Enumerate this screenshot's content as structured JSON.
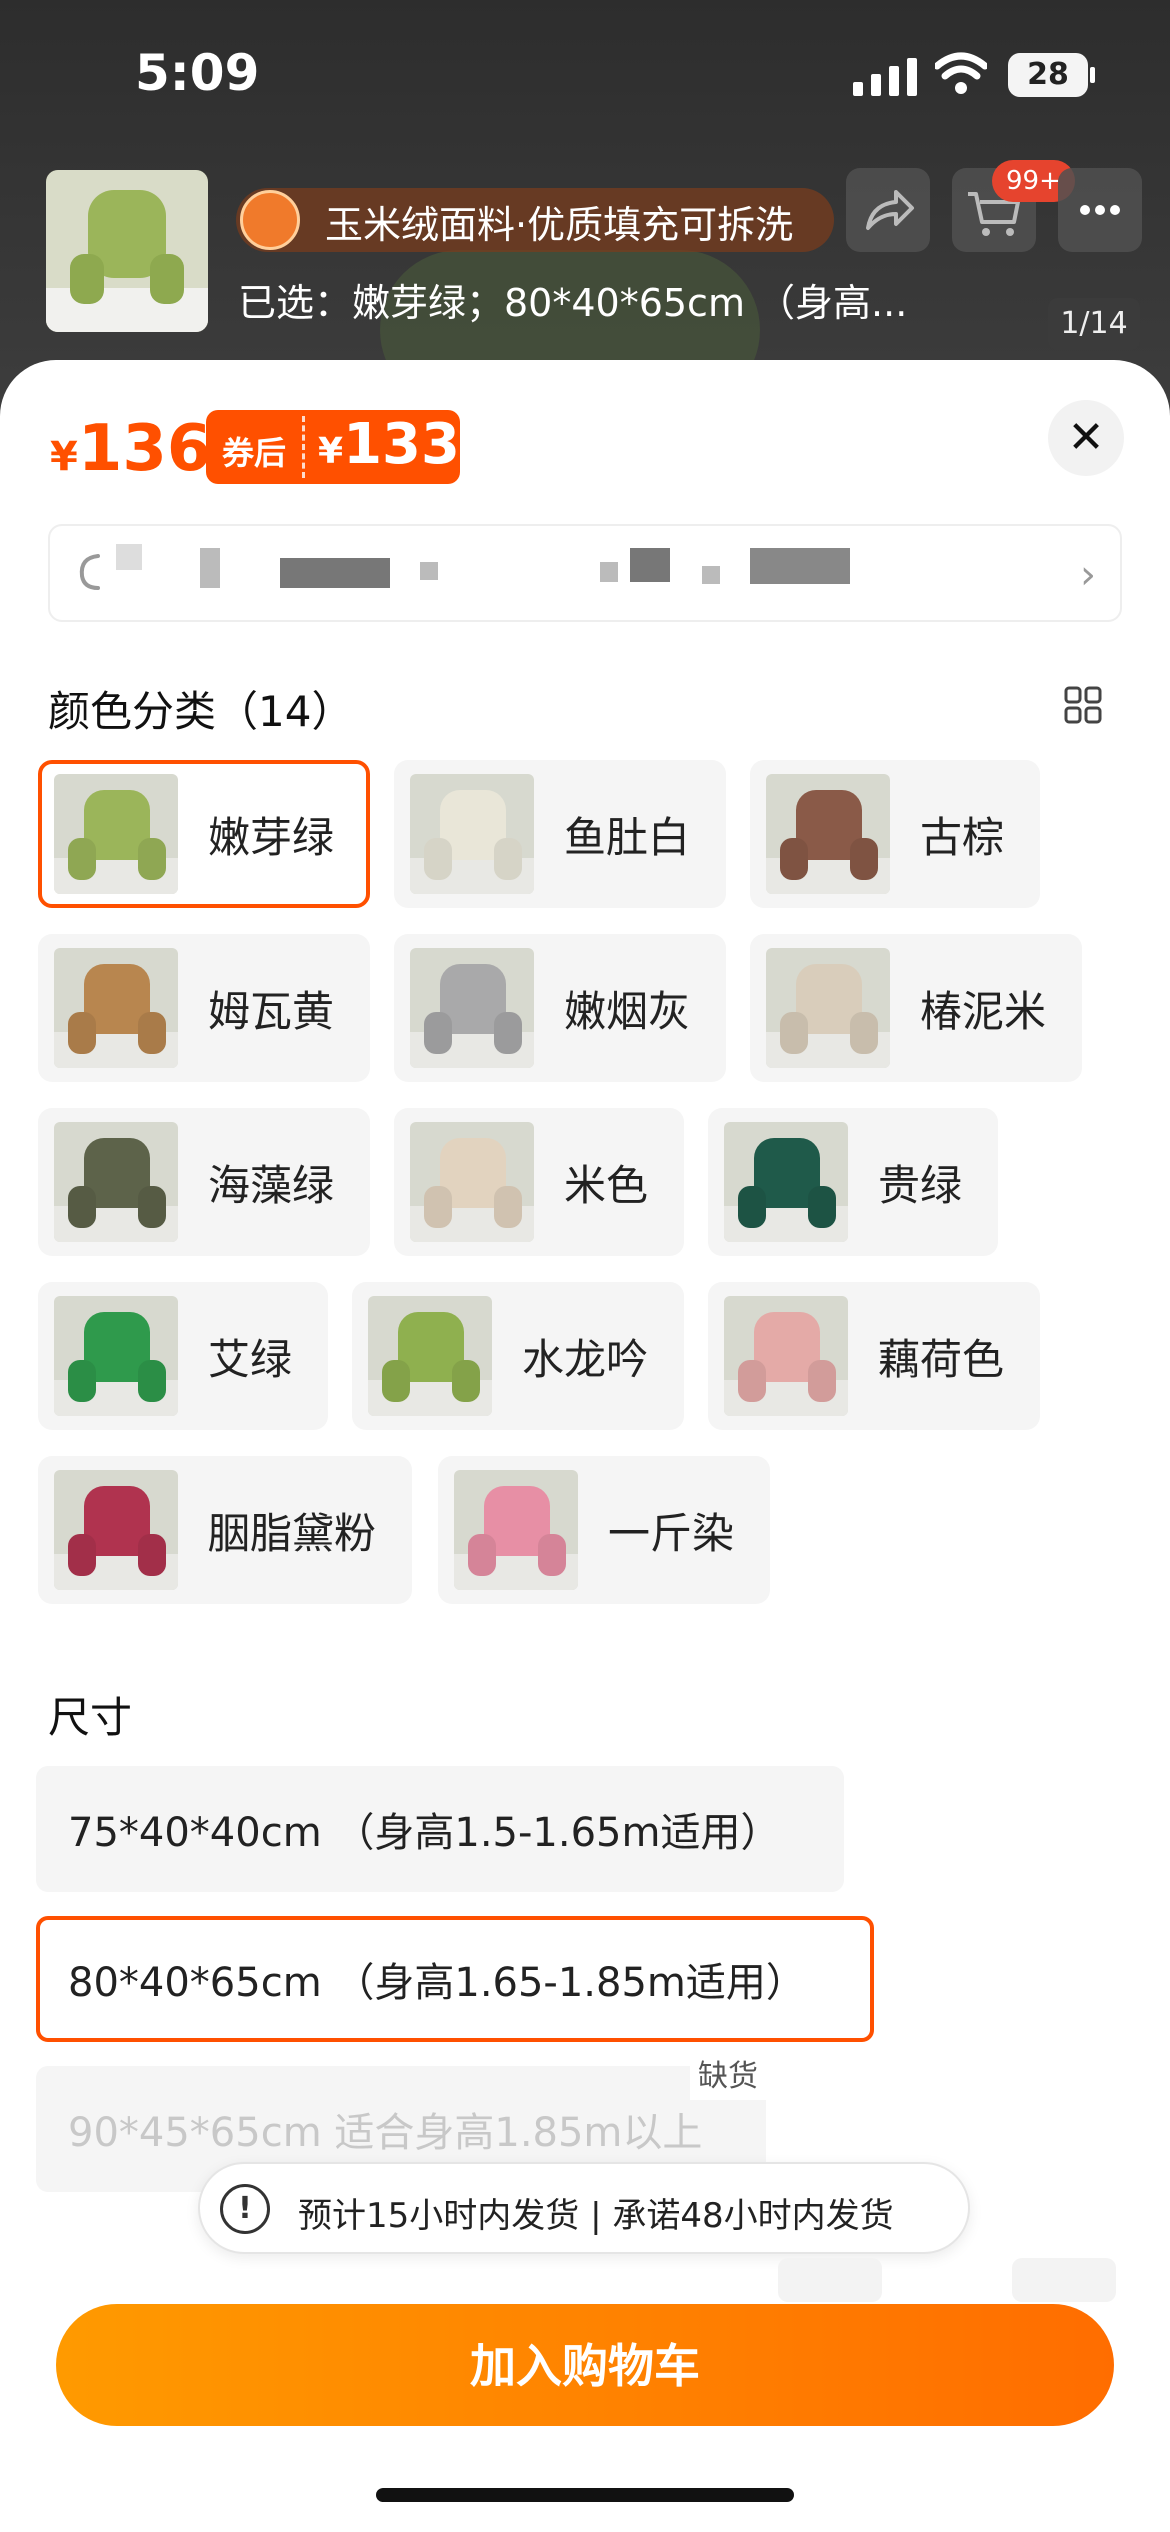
{
  "status_bar": {
    "time": "5:09",
    "battery": "28"
  },
  "header": {
    "title": "玉米绒面料·优质填充可拆洗",
    "selected": "已选：嫩芽绿；80*40*65cm （身高...",
    "cart_badge": "99+",
    "image_counter": "1/14"
  },
  "price": {
    "currency": "¥",
    "original": "136",
    "coupon_label": "券后",
    "coupon_price": "133"
  },
  "color_section": {
    "title": "颜色分类（14）",
    "options": [
      {
        "label": "嫩芽绿",
        "color": "#9bb55a",
        "selected": true
      },
      {
        "label": "鱼肚白",
        "color": "#e9e6d8"
      },
      {
        "label": "古棕",
        "color": "#8a5a48"
      },
      {
        "label": "姆瓦黄",
        "color": "#b8864f"
      },
      {
        "label": "嫩烟灰",
        "color": "#a9a9aa"
      },
      {
        "label": "椿泥米",
        "color": "#d9cdbb"
      },
      {
        "label": "海藻绿",
        "color": "#5d634a"
      },
      {
        "label": "米色",
        "color": "#e2d3bf"
      },
      {
        "label": "贵绿",
        "color": "#1f5a4a"
      },
      {
        "label": "艾绿",
        "color": "#2f9a4c"
      },
      {
        "label": "水龙吟",
        "color": "#8fb04f"
      },
      {
        "label": "藕荷色",
        "color": "#e4aaa7"
      },
      {
        "label": "胭脂黛粉",
        "color": "#b0334f"
      },
      {
        "label": "一斤染",
        "color": "#e78fa5"
      }
    ]
  },
  "size_section": {
    "title": "尺寸",
    "options": [
      {
        "label": "75*40*40cm （身高1.5-1.65m适用）"
      },
      {
        "label": "80*40*65cm （身高1.65-1.85m适用）",
        "selected": true
      },
      {
        "label": "90*45*65cm 适合身高1.85m以上",
        "disabled": true,
        "tag": "缺货"
      }
    ]
  },
  "shipping_notice": "预计15小时内发货 | 承诺48小时内发货",
  "add_to_cart": "加入购物车"
}
